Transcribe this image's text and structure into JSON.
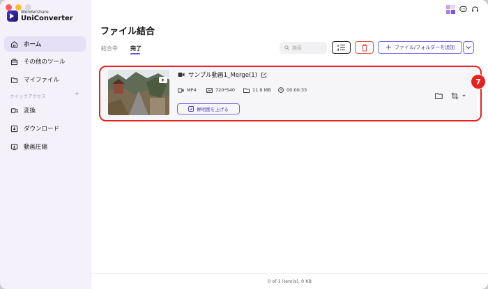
{
  "app": {
    "brand_small": "Wondershare",
    "brand_name": "UniConverter",
    "accent_color": "#6a4ee8",
    "highlight_color": "#e8201e"
  },
  "sidebar": {
    "items": [
      {
        "label": "ホーム",
        "icon": "home-icon",
        "active": true
      },
      {
        "label": "その他のツール",
        "icon": "toolbox-icon"
      },
      {
        "label": "マイファイル",
        "icon": "folder-icon"
      }
    ],
    "quick_access_label": "クイックアクセス",
    "quick_access_add": "+",
    "quick_items": [
      {
        "label": "変換",
        "icon": "convert-icon"
      },
      {
        "label": "ダウンロード",
        "icon": "download-icon"
      },
      {
        "label": "動画圧縮",
        "icon": "compress-icon"
      }
    ]
  },
  "main": {
    "title": "ファイル結合",
    "tabs": [
      {
        "label": "結合中",
        "active": false
      },
      {
        "label": "完了",
        "active": true
      }
    ],
    "search_placeholder": "検索",
    "add_button": "ファイル/フォルダーを追加",
    "add_plus": "+"
  },
  "file": {
    "name": "サンプル動画1_Merge(1)",
    "format": "MP4",
    "resolution": "720*540",
    "size": "11.9 MB",
    "duration": "00:00:33",
    "enhance_label": "鮮明度を上げる"
  },
  "annotation": {
    "step_number": "7"
  },
  "footer": {
    "status": "0 of 1 item(s), 0 KB"
  }
}
